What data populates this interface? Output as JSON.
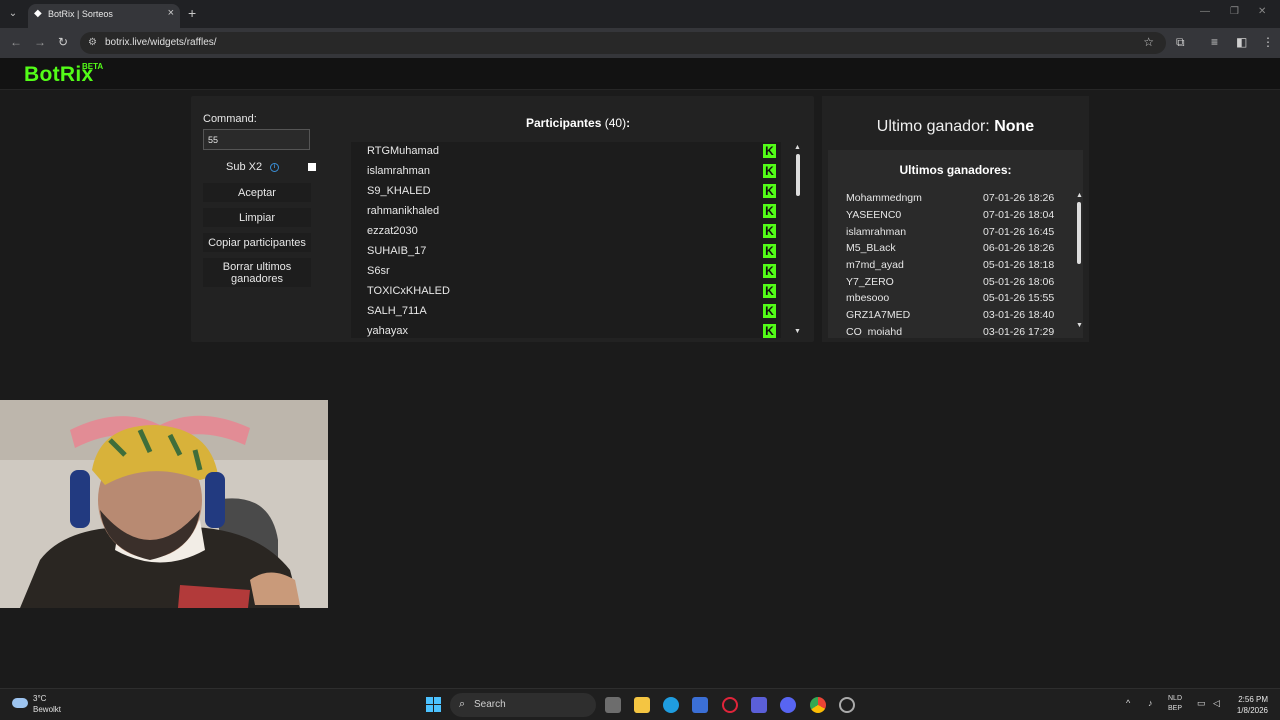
{
  "browser": {
    "tab_title": "BotRix | Sorteos",
    "url": "botrix.live/widgets/raffles/"
  },
  "site": {
    "logo": "BotRix",
    "logo_badge": "BETA"
  },
  "raffle": {
    "command_label": "Command:",
    "command_value": "55",
    "sub_label": "Sub X2",
    "buttons": {
      "accept": "Aceptar",
      "clear": "Limpiar",
      "copy": "Copiar participantes",
      "delete_winners_1": "Borrar ultimos",
      "delete_winners_2": "ganadores"
    },
    "participants_label": "Participantes",
    "participants_count": "(40)",
    "participants_suffix": ":",
    "participants": [
      "RTGMuhamad",
      "islamrahman",
      "S9_KHALED",
      "rahmanikhaled",
      "ezzat2030",
      "SUHAIB_17",
      "S6sr",
      "TOXICxKHALED",
      "SALH_711A",
      "yahayax"
    ]
  },
  "winners": {
    "last_winner_label": "Ultimo ganador:",
    "last_winner_value": "None",
    "recent_title": "Ultimos ganadores:",
    "list": [
      {
        "name": "Mohammedngm",
        "date": "07-01-26 18:26"
      },
      {
        "name": "YASEENC0",
        "date": "07-01-26 18:04"
      },
      {
        "name": "islamrahman",
        "date": "07-01-26 16:45"
      },
      {
        "name": "M5_BLack",
        "date": "06-01-26 18:26"
      },
      {
        "name": "m7md_ayad",
        "date": "05-01-26 18:18"
      },
      {
        "name": "Y7_ZERO",
        "date": "05-01-26 18:06"
      },
      {
        "name": "mbesooo",
        "date": "05-01-26 15:55"
      },
      {
        "name": "GRZ1A7MED",
        "date": "03-01-26 18:40"
      },
      {
        "name": "CO_mojahd",
        "date": "03-01-26 17:29"
      }
    ]
  },
  "taskbar": {
    "temperature": "3°C",
    "weather": "Bewolkt",
    "search_placeholder": "Search",
    "lang_1": "NLD",
    "lang_2": "BEP",
    "time": "2:56 PM",
    "date": "1/8/2026"
  },
  "colors": {
    "brand_green": "#53fc18",
    "info_blue": "#3b8fd6",
    "windows_blue": "#4cc2ff"
  }
}
